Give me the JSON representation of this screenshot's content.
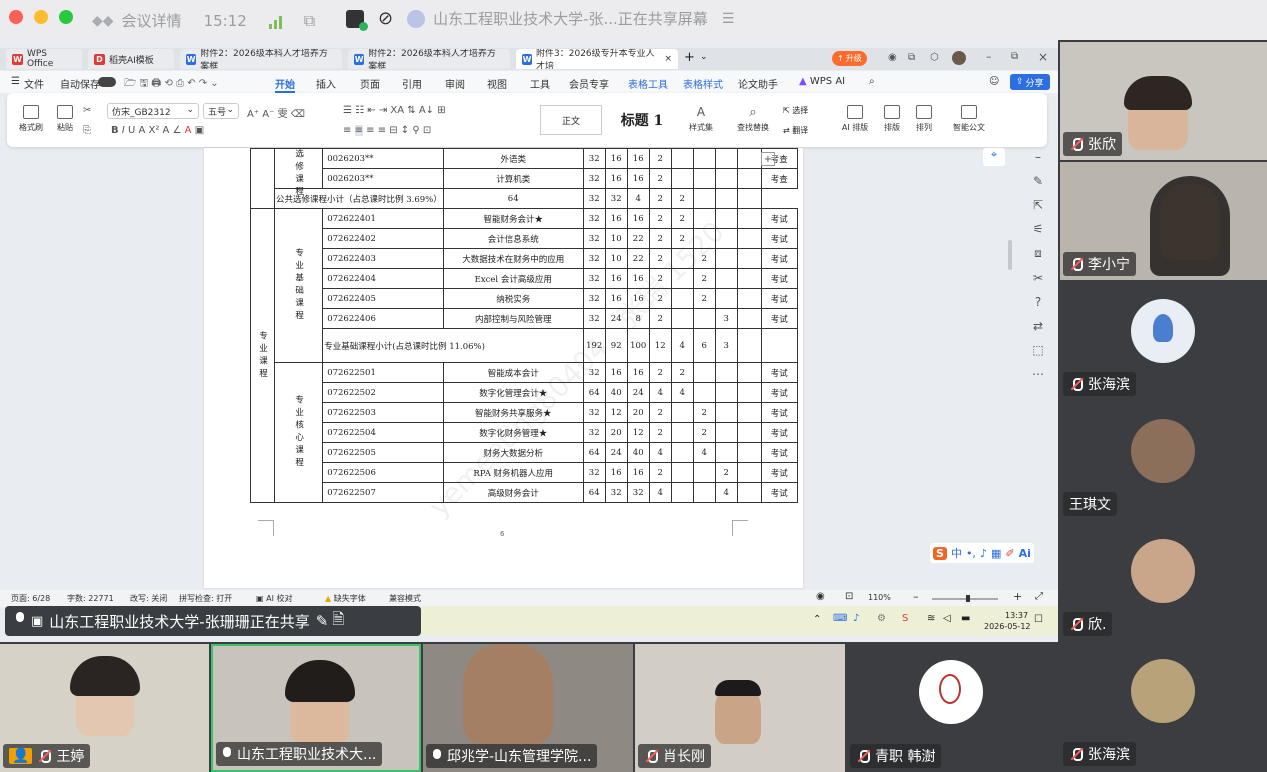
{
  "meeting": {
    "title_left": "会议详情",
    "time": "15:12",
    "share_title": "山东工程职业技术大学-张...正在共享屏幕"
  },
  "wps": {
    "tabs": [
      {
        "label": "WPS Office",
        "icon": "W",
        "color": "#e53935"
      },
      {
        "label": "稻壳AI模板",
        "icon": "D",
        "color": "#e53935"
      },
      {
        "label": "附件2：2026级本科人才培养方案框",
        "icon": "W",
        "color": "#2b6fe0"
      },
      {
        "label": "附件2：2026级本科人才培养方案框",
        "icon": "W",
        "color": "#2b6fe0"
      },
      {
        "label": "附件3：2026级专升本专业人才培",
        "icon": "W",
        "color": "#2b6fe0"
      }
    ],
    "upgrade": "升级",
    "menu": [
      "文件",
      "自动保存",
      "开始",
      "插入",
      "页面",
      "引用",
      "审阅",
      "视图",
      "工具",
      "会员专享",
      "表格工具",
      "表格样式",
      "论文助手",
      "WPS AI"
    ],
    "share": "分享",
    "ribbon": {
      "format_brush": "格式刷",
      "paste": "粘贴",
      "font": "仿宋_GB2312",
      "size": "五号",
      "style_normal": "正文",
      "style_heading": "标题 1",
      "style_set": "样式集",
      "find_replace": "查找替换",
      "select": "选择",
      "translate": "翻译",
      "ai_layout": "AI 排版",
      "layout": "排版",
      "arrange": "排列",
      "smart_doc": "智能公文"
    },
    "status": {
      "page": "页面: 6/28",
      "words": "字数: 22771",
      "revise": "改写: 关闭",
      "spell": "拼写检查: 打开",
      "ai_check": "AI 校对",
      "missing_font": "缺失字体",
      "compat": "兼容模式",
      "zoom": "110%"
    },
    "page_number": "6",
    "watermark": "yemeeting80404　张瑞 1520",
    "ime": "中"
  },
  "table": {
    "rows": [
      {
        "g1": "",
        "g2": "",
        "code": "0026203**",
        "name": "外语类",
        "v": [
          "32",
          "16",
          "16",
          "2",
          "",
          "",
          "",
          ""
        ],
        "exam": "考查"
      },
      {
        "g1": "",
        "g2": "",
        "code": "0026203**",
        "name": "计算机类",
        "v": [
          "32",
          "16",
          "16",
          "2",
          "",
          "",
          "",
          ""
        ],
        "exam": "考查"
      },
      {
        "sub": "公共选修课程小计（占总课时比例 3.69%）",
        "v": [
          "64",
          "32",
          "32",
          "4",
          "2",
          "2",
          "",
          ""
        ],
        "exam": ""
      },
      {
        "code": "072622401",
        "name": "智能财务会计★",
        "v": [
          "32",
          "16",
          "16",
          "2",
          "2",
          "",
          "",
          ""
        ],
        "exam": "考试"
      },
      {
        "code": "072622402",
        "name": "会计信息系统",
        "v": [
          "32",
          "10",
          "22",
          "2",
          "2",
          "",
          "",
          ""
        ],
        "exam": "考试"
      },
      {
        "code": "072622403",
        "name": "大数据技术在财务中的应用",
        "v": [
          "32",
          "10",
          "22",
          "2",
          "",
          "2",
          "",
          ""
        ],
        "exam": "考试"
      },
      {
        "code": "072622404",
        "name": "Excel 会计高级应用",
        "v": [
          "32",
          "16",
          "16",
          "2",
          "",
          "2",
          "",
          ""
        ],
        "exam": "考试"
      },
      {
        "code": "072622405",
        "name": "纳税实务",
        "v": [
          "32",
          "16",
          "16",
          "2",
          "",
          "2",
          "",
          ""
        ],
        "exam": "考试"
      },
      {
        "code": "072622406",
        "name": "内部控制与风险管理",
        "v": [
          "32",
          "24",
          "8",
          "2",
          "",
          "",
          "3",
          ""
        ],
        "exam": "考试"
      },
      {
        "sub": "专业基础课程小计(占总课时比例 11.06%)",
        "v": [
          "192",
          "92",
          "100",
          "12",
          "4",
          "6",
          "3",
          ""
        ],
        "exam": ""
      },
      {
        "code": "072622501",
        "name": "智能成本会计",
        "v": [
          "32",
          "16",
          "16",
          "2",
          "2",
          "",
          "",
          ""
        ],
        "exam": "考试"
      },
      {
        "code": "072622502",
        "name": "数字化管理会计★",
        "v": [
          "64",
          "40",
          "24",
          "4",
          "4",
          "",
          "",
          ""
        ],
        "exam": "考试"
      },
      {
        "code": "072622503",
        "name": "智能财务共享服务★",
        "v": [
          "32",
          "12",
          "20",
          "2",
          "",
          "2",
          "",
          ""
        ],
        "exam": "考试"
      },
      {
        "code": "072622504",
        "name": "数字化财务管理★",
        "v": [
          "32",
          "20",
          "12",
          "2",
          "",
          "2",
          "",
          ""
        ],
        "exam": "考试"
      },
      {
        "code": "072622505",
        "name": "财务大数据分析",
        "v": [
          "64",
          "24",
          "40",
          "4",
          "",
          "4",
          "",
          ""
        ],
        "exam": "考试"
      },
      {
        "code": "072622506",
        "name": "RPA 财务机器人应用",
        "v": [
          "32",
          "16",
          "16",
          "2",
          "",
          "",
          "2",
          ""
        ],
        "exam": "考试"
      },
      {
        "code": "072622507",
        "name": "高级财务会计",
        "v": [
          "64",
          "32",
          "32",
          "4",
          "",
          "",
          "4",
          ""
        ],
        "exam": "考试"
      }
    ],
    "group_elective": "选修课程",
    "group_major": "专业课程",
    "group_basic": "专业基础课程",
    "group_core": "专业核心课程"
  },
  "share_banner": "山东工程职业技术大学-张珊珊正在共享",
  "clock": {
    "time": "13:37",
    "date": "2026-05-12"
  },
  "participants_side": [
    {
      "name": "张欣"
    },
    {
      "name": "李小宁"
    },
    {
      "name": "张海滨"
    },
    {
      "name": "王琪文"
    },
    {
      "name": "欣."
    },
    {
      "name": "张海滨"
    }
  ],
  "participants_bottom": [
    {
      "name": "王婷"
    },
    {
      "name": "山东工程职业技术大..."
    },
    {
      "name": "邱兆学-山东管理学院..."
    },
    {
      "name": "肖长刚"
    },
    {
      "name": "青职 韩澍"
    }
  ]
}
